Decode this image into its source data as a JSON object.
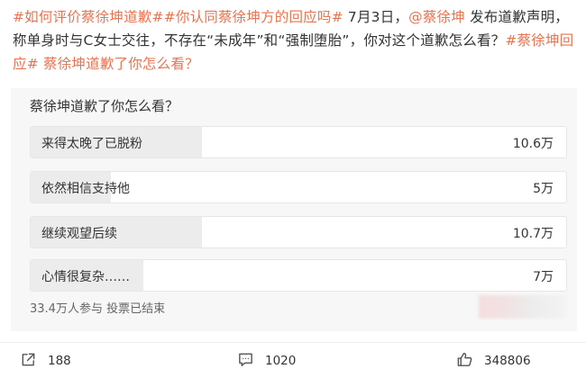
{
  "post": {
    "tag1": "#如何评价蔡徐坤道歉#",
    "tag2": "#你认同蔡徐坤方的回应吗#",
    "text1": " 7月3日，",
    "mention": "@蔡徐坤",
    "text2": " 发布道歉声明，称单身时与C女士交往，不存在“未成年”和“强制堕胎”，你对这个道歉怎么看？",
    "tag3": "#蔡徐坤回应#",
    "text3": " ",
    "tag4": "蔡徐坤道歉了你怎么看？"
  },
  "poll": {
    "question": "蔡徐坤道歉了你怎么看？",
    "options": [
      {
        "label": "来得太晚了已脱粉",
        "count": "10.6万",
        "share": 0.32
      },
      {
        "label": "依然相信支持他",
        "count": "5万",
        "share": 0.15
      },
      {
        "label": "继续观望后续",
        "count": "10.7万",
        "share": 0.32
      },
      {
        "label": "心情很复杂……",
        "count": "7万",
        "share": 0.21
      }
    ],
    "footer": "33.4万人参与 投票已结束"
  },
  "actions": {
    "share_count": "188",
    "comment_count": "1020",
    "like_count": "348806"
  },
  "colors": {
    "link": "#eb7350",
    "text": "#333333",
    "muted": "#666666",
    "card_bg": "#f7f7f7",
    "bar_fill": "#ececec"
  }
}
